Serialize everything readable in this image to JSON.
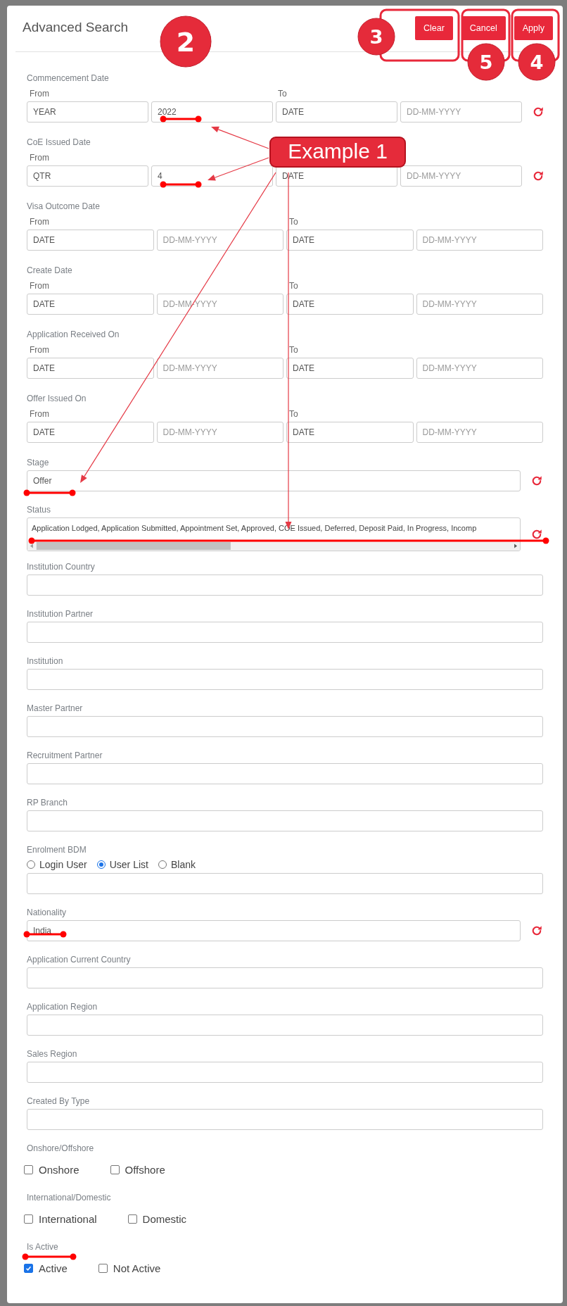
{
  "dialog": {
    "title": "Advanced Search",
    "buttons": [
      "Clear",
      "Cancel",
      "Apply"
    ]
  },
  "fields": [
    {
      "kind": "date_range",
      "label": "Commencement Date",
      "from_label": "From",
      "to_label": "To",
      "inputs": [
        {
          "value": "YEAR"
        },
        {
          "value": "2022"
        },
        {
          "value": "DATE"
        },
        {
          "placeholder": "DD-MM-YYYY"
        }
      ],
      "reset": true
    },
    {
      "kind": "date_range",
      "label": "CoE Issued Date",
      "from_label": "From",
      "inputs": [
        {
          "value": "QTR"
        },
        {
          "value": "4"
        },
        {
          "value": "DATE"
        },
        {
          "placeholder": "DD-MM-YYYY"
        }
      ],
      "reset": true
    },
    {
      "kind": "date_range",
      "label": "Visa Outcome Date",
      "from_label": "From",
      "to_label": "To",
      "inputs": [
        {
          "value": "DATE"
        },
        {
          "placeholder": "DD-MM-YYYY"
        },
        {
          "value": "DATE"
        },
        {
          "placeholder": "DD-MM-YYYY"
        }
      ],
      "reset": false
    },
    {
      "kind": "date_range",
      "label": "Create Date",
      "from_label": "From",
      "to_label": "To",
      "inputs": [
        {
          "value": "DATE"
        },
        {
          "placeholder": "DD-MM-YYYY"
        },
        {
          "value": "DATE"
        },
        {
          "placeholder": "DD-MM-YYYY"
        }
      ],
      "reset": false
    },
    {
      "kind": "date_range",
      "label": "Application Received On",
      "from_label": "From",
      "to_label": "To",
      "inputs": [
        {
          "value": "DATE"
        },
        {
          "placeholder": "DD-MM-YYYY"
        },
        {
          "value": "DATE"
        },
        {
          "placeholder": "DD-MM-YYYY"
        }
      ],
      "reset": false
    },
    {
      "kind": "date_range",
      "label": "Offer Issued On",
      "from_label": "From",
      "to_label": "To",
      "inputs": [
        {
          "value": "DATE"
        },
        {
          "placeholder": "DD-MM-YYYY"
        },
        {
          "value": "DATE"
        },
        {
          "placeholder": "DD-MM-YYYY"
        }
      ],
      "reset": false
    },
    {
      "kind": "text",
      "label": "Stage",
      "value": "Offer",
      "reset": true
    },
    {
      "kind": "multi",
      "label": "Status",
      "value": "Application Lodged, Application Submitted, Appointment Set, Approved, COE Issued, Deferred, Deposit Paid, In Progress, Incomp",
      "reset": true
    },
    {
      "kind": "text",
      "label": "Institution Country",
      "reset": false
    },
    {
      "kind": "text",
      "label": "Institution Partner",
      "reset": false
    },
    {
      "kind": "text",
      "label": "Institution",
      "reset": false
    },
    {
      "kind": "text",
      "label": "Master Partner",
      "reset": false
    },
    {
      "kind": "text",
      "label": "Recruitment Partner",
      "reset": false
    },
    {
      "kind": "text",
      "label": "RP Branch",
      "reset": false
    },
    {
      "kind": "radio",
      "label": "Enrolment BDM",
      "options": [
        {
          "label": "Login User",
          "selected": false
        },
        {
          "label": "User List",
          "selected": true
        },
        {
          "label": "Blank",
          "selected": false
        }
      ]
    },
    {
      "kind": "text",
      "label": "Nationality",
      "value": "India",
      "reset": true
    },
    {
      "kind": "text",
      "label": "Application Current Country",
      "reset": false
    },
    {
      "kind": "text",
      "label": "Application Region",
      "reset": false
    },
    {
      "kind": "text",
      "label": "Sales Region",
      "reset": false
    },
    {
      "kind": "text",
      "label": "Created By Type",
      "reset": false
    },
    {
      "kind": "checks",
      "label": "Onshore/Offshore",
      "options": [
        {
          "label": "Onshore",
          "checked": false
        },
        {
          "label": "Offshore",
          "checked": false
        }
      ]
    },
    {
      "kind": "checks",
      "label": "International/Domestic",
      "options": [
        {
          "label": "International",
          "checked": false
        },
        {
          "label": "Domestic",
          "checked": false
        }
      ]
    },
    {
      "kind": "checks",
      "label": "Is Active",
      "options": [
        {
          "label": "Active",
          "checked": true
        },
        {
          "label": "Not Active",
          "checked": false
        }
      ]
    }
  ],
  "annotations": {
    "badges": [
      "2",
      "3",
      "5",
      "4"
    ],
    "callout": "Example 1"
  }
}
